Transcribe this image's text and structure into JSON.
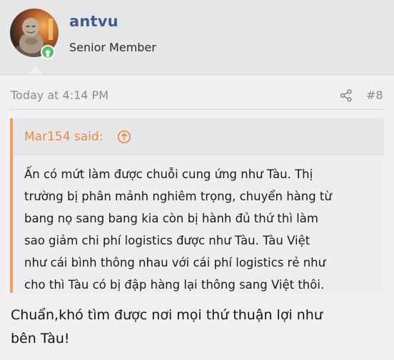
{
  "author": {
    "username": "antvu",
    "title": "Senior Member",
    "avatar_icon": "avatar-buddha-statue",
    "status_icon": "online-status-icon",
    "status_color": "#5cbd6b"
  },
  "post": {
    "timestamp": "Today at 4:14 PM",
    "share_icon": "share-icon",
    "number": "#8",
    "quote": {
      "author_label": "Mar154 said:",
      "jump_icon": "arrow-up-circle-icon",
      "accent_color": "#f2a15c",
      "text": "Ấn có mứt làm được chuỗi cung ứng như Tàu. Thị\ntrường bị phân mảnh nghiêm trọng, chuyển hàng từ\nbang nọ sang bang kia còn bị hành đủ thứ thì làm\nsao giảm chi phí logistics được như Tàu. Tàu Việt\nnhư cái bình thông nhau với cái phí logistics rẻ như\ncho thì Tàu có bị đập hàng lại thông sang Việt thôi."
    },
    "reply_text": "Chuẩn,khó tìm được nơi mọi thứ thuận lợi như\nbên Tàu!"
  }
}
